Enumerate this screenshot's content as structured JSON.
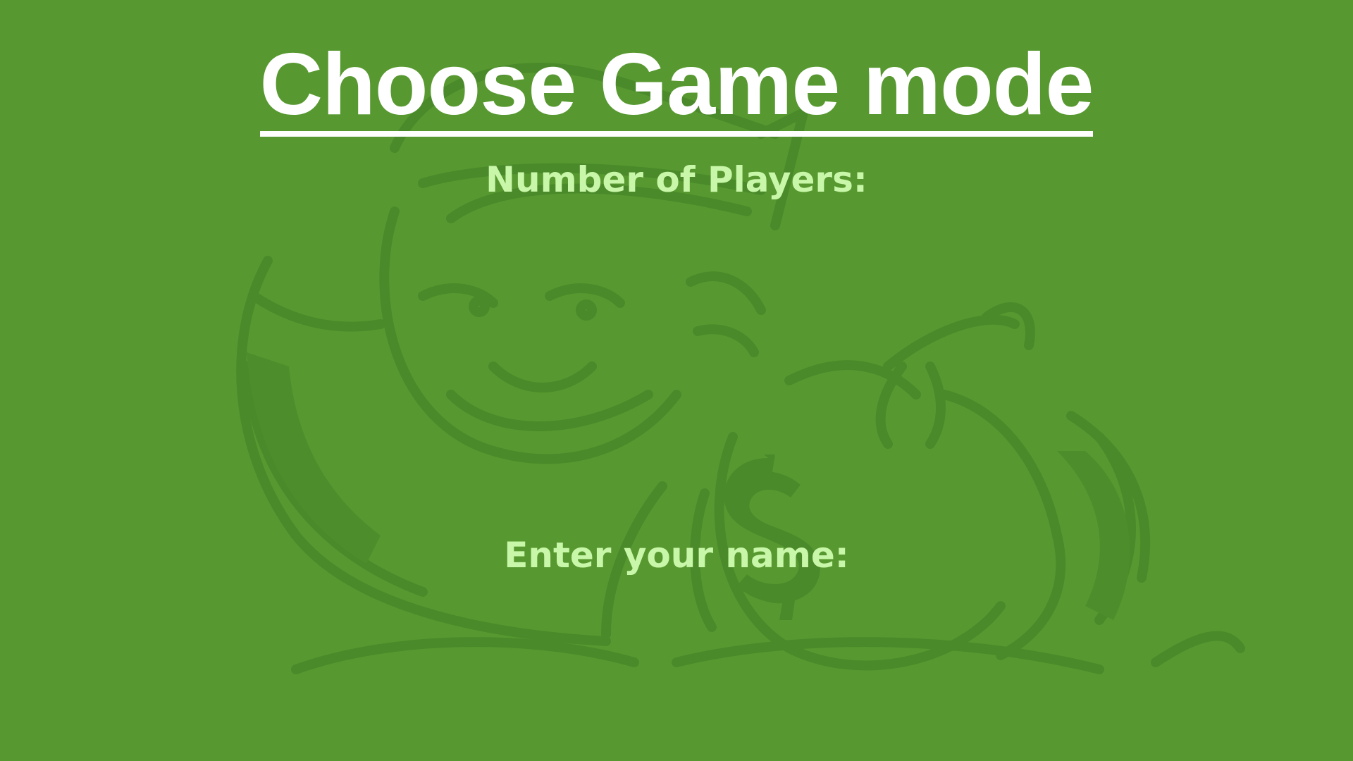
{
  "screen": {
    "title": "Choose Game mode",
    "players_label": "Number of Players:",
    "name_label": "Enter your name:"
  },
  "colors": {
    "background": "#579930",
    "title": "#ffffff",
    "labels": "#c9f7a9",
    "art_shade": "#4a8a2a"
  },
  "background_art": {
    "icon": "rich-uncle-mascot-with-money-bag"
  }
}
